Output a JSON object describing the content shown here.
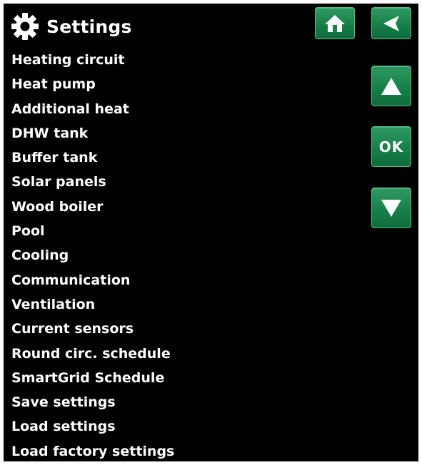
{
  "header": {
    "title": "Settings",
    "icon": "gear-icon"
  },
  "menu": {
    "items": [
      "Heating circuit",
      "Heat pump",
      "Additional heat",
      "DHW tank",
      "Buffer tank",
      "Solar panels",
      "Wood boiler",
      "Pool",
      "Cooling",
      "Communication",
      "Ventilation",
      "Current sensors",
      "Round circ. schedule",
      "SmartGrid Schedule",
      "Save settings",
      "Load settings",
      "Load factory settings"
    ]
  },
  "buttons": {
    "home_icon": "home-icon",
    "back_icon": "back-arrow-icon",
    "up_icon": "up-arrow-icon",
    "ok_label": "OK",
    "down_icon": "down-arrow-icon"
  },
  "colors": {
    "background": "#000000",
    "text": "#ffffff",
    "button_green": "#17804a",
    "button_border": "#4fbf85"
  }
}
